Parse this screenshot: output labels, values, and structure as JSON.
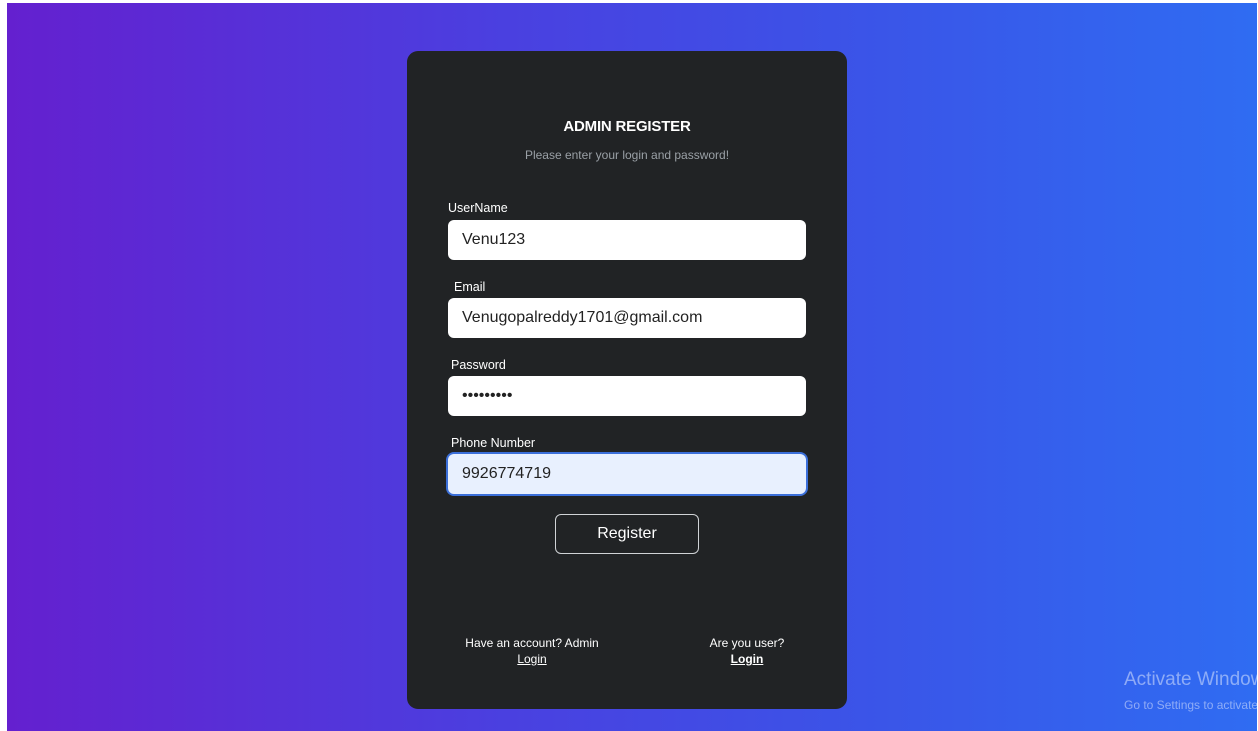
{
  "form": {
    "title": "ADMIN REGISTER",
    "subtitle": "Please enter your login and password!",
    "username": {
      "label": "UserName",
      "value": "Venu123"
    },
    "email": {
      "label": "Email",
      "value": "Venugopalreddy1701@gmail.com"
    },
    "password": {
      "label": "Password",
      "value": "•••••••••"
    },
    "phone": {
      "label": "Phone Number",
      "value": "9926774719"
    },
    "register_label": "Register"
  },
  "footer": {
    "admin_prompt": "Have an account? Admin",
    "admin_link": "Login",
    "user_prompt": "Are you user?",
    "user_link": "Login"
  },
  "watermark": {
    "title": "Activate Windows",
    "subtitle": "Go to Settings to activate Windows."
  },
  "colors": {
    "card_bg": "#212325",
    "gradient_start": "#6420cf",
    "gradient_end": "#2f6cf2",
    "focus_ring": "#3b6fd9"
  }
}
